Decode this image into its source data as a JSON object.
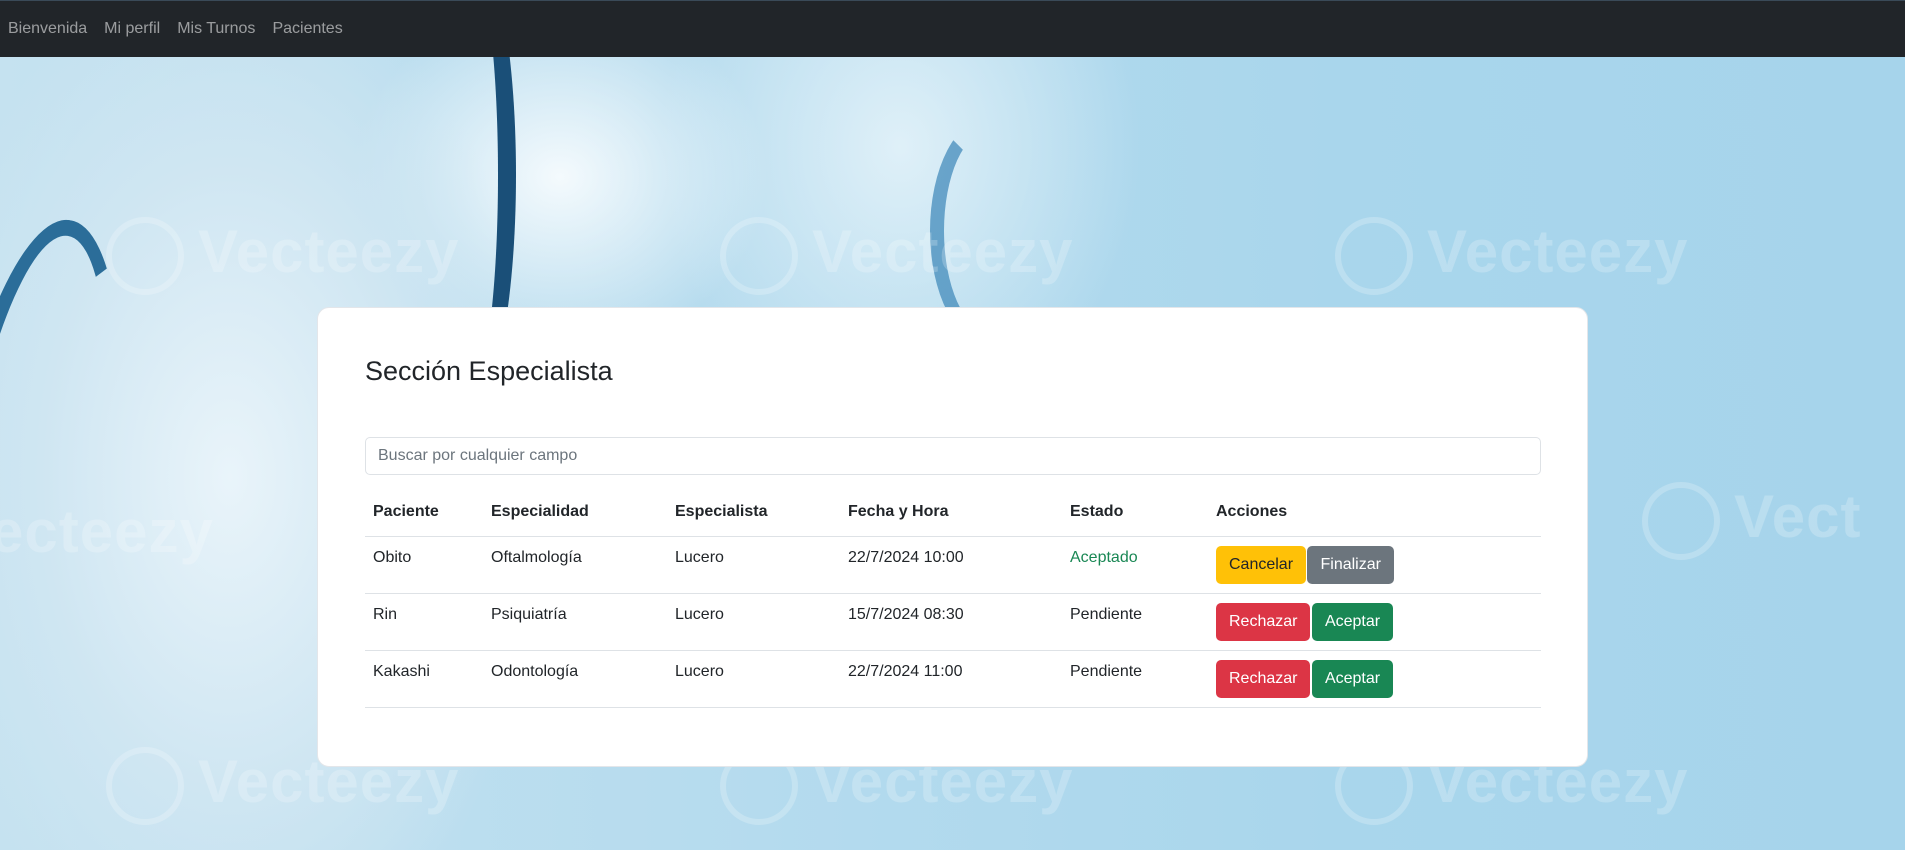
{
  "nav": {
    "items": [
      {
        "label": "Bienvenida"
      },
      {
        "label": "Mi perfil"
      },
      {
        "label": "Mis Turnos"
      },
      {
        "label": "Pacientes"
      }
    ]
  },
  "background": {
    "watermark_text": "Vecteezy",
    "watermark_text_cut": "ecteezy",
    "watermark_text_cut_right": "Vect"
  },
  "card": {
    "title": "Sección Especialista",
    "search": {
      "placeholder": "Buscar por cualquier campo",
      "value": ""
    },
    "table": {
      "columns": [
        "Paciente",
        "Especialidad",
        "Especialista",
        "Fecha y Hora",
        "Estado",
        "Acciones"
      ],
      "rows": [
        {
          "paciente": "Obito",
          "especialidad": "Oftalmología",
          "especialista": "Lucero",
          "fecha": "22/7/2024 10:00",
          "estado": "Aceptado",
          "actions": [
            "Cancelar",
            "Finalizar"
          ]
        },
        {
          "paciente": "Rin",
          "especialidad": "Psiquiatría",
          "especialista": "Lucero",
          "fecha": "15/7/2024 08:30",
          "estado": "Pendiente",
          "actions": [
            "Rechazar",
            "Aceptar"
          ]
        },
        {
          "paciente": "Kakashi",
          "especialidad": "Odontología",
          "especialista": "Lucero",
          "fecha": "22/7/2024 11:00",
          "estado": "Pendiente",
          "actions": [
            "Rechazar",
            "Aceptar"
          ]
        }
      ]
    }
  },
  "colors": {
    "navbar": "#212529",
    "estado_aceptado": "#198754",
    "warning": "#ffc107",
    "secondary": "#6c757d",
    "danger": "#dc3545",
    "success": "#198754"
  }
}
